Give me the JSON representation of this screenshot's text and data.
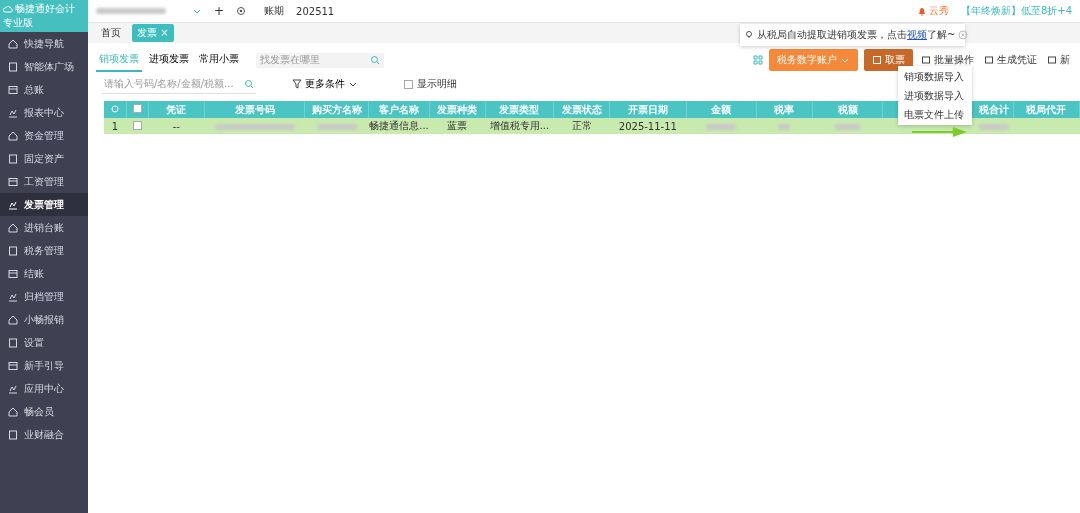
{
  "sidebar": {
    "product": "畅捷通好会计",
    "edition": "专业版",
    "items": [
      {
        "label": "快捷导航",
        "selected": false
      },
      {
        "label": "智能体广场",
        "selected": false
      },
      {
        "label": "总账",
        "selected": false
      },
      {
        "label": "报表中心",
        "selected": false
      },
      {
        "label": "资金管理",
        "selected": false
      },
      {
        "label": "固定资产",
        "selected": false
      },
      {
        "label": "工资管理",
        "selected": false
      },
      {
        "label": "发票管理",
        "selected": true
      },
      {
        "label": "进销台账",
        "selected": false
      },
      {
        "label": "税务管理",
        "selected": false
      },
      {
        "label": "结账",
        "selected": false
      },
      {
        "label": "归档管理",
        "selected": false
      },
      {
        "label": "小畅报销",
        "selected": false
      },
      {
        "label": "设置",
        "selected": false
      },
      {
        "label": "新手引导",
        "selected": false
      },
      {
        "label": "应用中心",
        "selected": false
      },
      {
        "label": "畅会员",
        "selected": false
      },
      {
        "label": "业财融合",
        "selected": false
      }
    ]
  },
  "topbar": {
    "add": "+",
    "period_label": "账期",
    "period": "202511",
    "user": "云秀",
    "promo": "【年终焕新】低至8折+4"
  },
  "page_tabs": [
    {
      "label": "首页",
      "selected": false,
      "closable": false
    },
    {
      "label": "发票",
      "selected": true,
      "closable": true
    }
  ],
  "close_glyph": "×",
  "invoice_tabs": [
    {
      "label": "销项发票",
      "selected": true
    },
    {
      "label": "进项发票",
      "selected": false
    },
    {
      "label": "常用小票",
      "selected": false
    }
  ],
  "help_search": {
    "placeholder": "找发票在哪里"
  },
  "tooltip": {
    "before": "从税局自动提取进销项发票，点击",
    "link": "视频",
    "after": "了解~"
  },
  "toolbar": [
    {
      "label": "税务数字账户",
      "kind": "primary"
    },
    {
      "label": "取票",
      "kind": "dark"
    },
    {
      "label": "批量操作",
      "kind": "plain"
    },
    {
      "label": "生成凭证",
      "kind": "plain"
    },
    {
      "label": "新",
      "kind": "plain"
    }
  ],
  "filter": {
    "placeholder": "请输入号码/名称/金额/税额...",
    "more": "更多条件",
    "detail": {
      "label": "显示明细",
      "checked": false
    }
  },
  "menu": [
    "销项数据导入",
    "进项数据导入",
    "电票文件上传"
  ],
  "table": {
    "select_all": false,
    "columns": [
      "凭证",
      "发票号码",
      "购买方名称",
      "客户名称",
      "发票种类",
      "发票类型",
      "发票状态",
      "开票日期",
      "金额",
      "税率",
      "税额",
      "税合计",
      "税局代开"
    ],
    "rows": [
      {
        "index": "1",
        "selected": false,
        "cells": [
          "--",
          "",
          "",
          "畅捷通信息...",
          "蓝票",
          "增值税专用...",
          "正常",
          "2025-11-11",
          "",
          "",
          "",
          "",
          ""
        ]
      }
    ]
  }
}
